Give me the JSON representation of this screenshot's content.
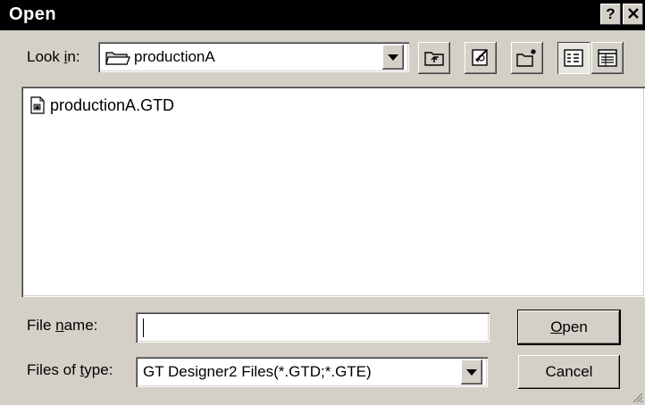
{
  "window": {
    "title": "Open",
    "help_label": "?"
  },
  "look_in": {
    "label_pre": "Look ",
    "label_key": "i",
    "label_post": "n:",
    "value": "productionA"
  },
  "toolbar": {
    "up_icon": "up-one-level-icon",
    "desktop_icon": "desktop-icon",
    "new_folder_icon": "new-folder-icon",
    "list_icon": "list-view-icon",
    "details_icon": "details-view-icon"
  },
  "files": [
    {
      "name": "productionA.GTD",
      "icon": "document-icon"
    }
  ],
  "file_name": {
    "label_pre": "File ",
    "label_key": "n",
    "label_post": "ame:",
    "value": ""
  },
  "file_type": {
    "label_pre": "Files of ",
    "label_key": "t",
    "label_post": "ype:",
    "value": "GT Designer2 Files(*.GTD;*.GTE)"
  },
  "buttons": {
    "open_key": "O",
    "open_rest": "pen",
    "cancel": "Cancel"
  }
}
